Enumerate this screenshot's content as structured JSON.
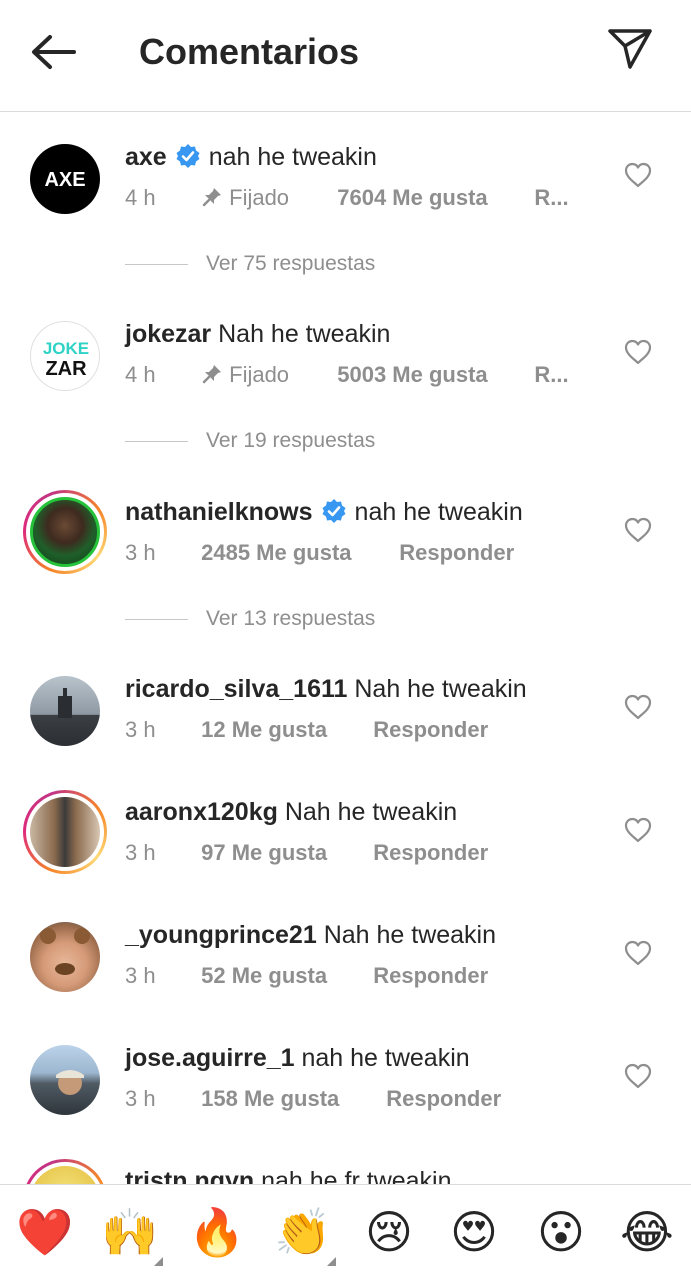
{
  "header": {
    "title": "Comentarios"
  },
  "comments": [
    {
      "username": "axe",
      "verified": true,
      "text": "nah he tweakin",
      "time": "4 h",
      "pinned_label": "Fijado",
      "likes": "7604 Me gusta",
      "action": "R...",
      "replies": "Ver 75 respuestas",
      "avatar_text": "AXE"
    },
    {
      "username": "jokezar",
      "verified": false,
      "text": "Nah he tweakin",
      "time": "4 h",
      "pinned_label": "Fijado",
      "likes": "5003 Me gusta",
      "action": "R...",
      "replies": "Ver 19 respuestas",
      "avatar_text_top": "JOKE",
      "avatar_text_bottom": "ZAR"
    },
    {
      "username": "nathanielknows",
      "verified": true,
      "text": "nah he tweakin",
      "time": "3 h",
      "likes": "2485 Me gusta",
      "action": "Responder",
      "replies": "Ver 13 respuestas"
    },
    {
      "username": "ricardo_silva_1611",
      "verified": false,
      "text": "Nah he tweakin",
      "time": "3 h",
      "likes": "12 Me gusta",
      "action": "Responder"
    },
    {
      "username": "aaronx120kg",
      "verified": false,
      "text": "Nah he tweakin",
      "time": "3 h",
      "likes": "97 Me gusta",
      "action": "Responder"
    },
    {
      "username": "_youngprince21",
      "verified": false,
      "text": "Nah he tweakin",
      "time": "3 h",
      "likes": "52 Me gusta",
      "action": "Responder"
    },
    {
      "username": "jose.aguirre_1",
      "verified": false,
      "text": "nah he tweakin",
      "time": "3 h",
      "likes": "158 Me gusta",
      "action": "Responder"
    },
    {
      "username": "tristn.ngyn",
      "verified": false,
      "text": "nah he fr tweakin"
    }
  ],
  "emoji_bar": [
    {
      "name": "red-heart",
      "glyph": "❤️"
    },
    {
      "name": "raising-hands",
      "glyph": "🙌"
    },
    {
      "name": "fire",
      "glyph": "🔥"
    },
    {
      "name": "clapping-hands",
      "glyph": "👏"
    },
    {
      "name": "crying-face",
      "glyph": "😢"
    },
    {
      "name": "heart-eyes",
      "glyph": "😍"
    },
    {
      "name": "astonished-face",
      "glyph": "😮"
    },
    {
      "name": "tears-of-joy",
      "glyph": "😂"
    }
  ],
  "colors": {
    "text": "#262626",
    "secondary": "#8e8e8e",
    "verified": "#3897f0",
    "divider": "#dbdbdb"
  }
}
